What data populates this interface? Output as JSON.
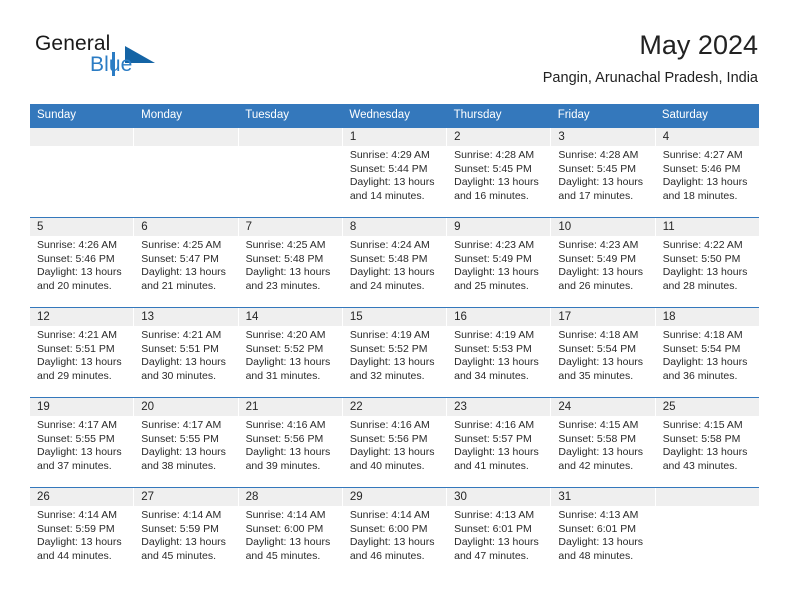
{
  "brand": {
    "name_part1": "General",
    "name_part2": "Blue"
  },
  "header": {
    "title": "May 2024",
    "location": "Pangin, Arunachal Pradesh, India"
  },
  "colors": {
    "header_blue": "#3478bc",
    "brand_blue": "#2b7cc4",
    "date_band_gray": "#efefef",
    "text": "#2a2a2a"
  },
  "weekdays": [
    "Sunday",
    "Monday",
    "Tuesday",
    "Wednesday",
    "Thursday",
    "Friday",
    "Saturday"
  ],
  "weeks": [
    [
      {
        "date": "",
        "sunrise": "",
        "sunset": "",
        "daylight": "",
        "empty": true
      },
      {
        "date": "",
        "sunrise": "",
        "sunset": "",
        "daylight": "",
        "empty": true
      },
      {
        "date": "",
        "sunrise": "",
        "sunset": "",
        "daylight": "",
        "empty": true
      },
      {
        "date": "1",
        "sunrise": "Sunrise: 4:29 AM",
        "sunset": "Sunset: 5:44 PM",
        "daylight": "Daylight: 13 hours and 14 minutes."
      },
      {
        "date": "2",
        "sunrise": "Sunrise: 4:28 AM",
        "sunset": "Sunset: 5:45 PM",
        "daylight": "Daylight: 13 hours and 16 minutes."
      },
      {
        "date": "3",
        "sunrise": "Sunrise: 4:28 AM",
        "sunset": "Sunset: 5:45 PM",
        "daylight": "Daylight: 13 hours and 17 minutes."
      },
      {
        "date": "4",
        "sunrise": "Sunrise: 4:27 AM",
        "sunset": "Sunset: 5:46 PM",
        "daylight": "Daylight: 13 hours and 18 minutes."
      }
    ],
    [
      {
        "date": "5",
        "sunrise": "Sunrise: 4:26 AM",
        "sunset": "Sunset: 5:46 PM",
        "daylight": "Daylight: 13 hours and 20 minutes."
      },
      {
        "date": "6",
        "sunrise": "Sunrise: 4:25 AM",
        "sunset": "Sunset: 5:47 PM",
        "daylight": "Daylight: 13 hours and 21 minutes."
      },
      {
        "date": "7",
        "sunrise": "Sunrise: 4:25 AM",
        "sunset": "Sunset: 5:48 PM",
        "daylight": "Daylight: 13 hours and 23 minutes."
      },
      {
        "date": "8",
        "sunrise": "Sunrise: 4:24 AM",
        "sunset": "Sunset: 5:48 PM",
        "daylight": "Daylight: 13 hours and 24 minutes."
      },
      {
        "date": "9",
        "sunrise": "Sunrise: 4:23 AM",
        "sunset": "Sunset: 5:49 PM",
        "daylight": "Daylight: 13 hours and 25 minutes."
      },
      {
        "date": "10",
        "sunrise": "Sunrise: 4:23 AM",
        "sunset": "Sunset: 5:49 PM",
        "daylight": "Daylight: 13 hours and 26 minutes."
      },
      {
        "date": "11",
        "sunrise": "Sunrise: 4:22 AM",
        "sunset": "Sunset: 5:50 PM",
        "daylight": "Daylight: 13 hours and 28 minutes."
      }
    ],
    [
      {
        "date": "12",
        "sunrise": "Sunrise: 4:21 AM",
        "sunset": "Sunset: 5:51 PM",
        "daylight": "Daylight: 13 hours and 29 minutes."
      },
      {
        "date": "13",
        "sunrise": "Sunrise: 4:21 AM",
        "sunset": "Sunset: 5:51 PM",
        "daylight": "Daylight: 13 hours and 30 minutes."
      },
      {
        "date": "14",
        "sunrise": "Sunrise: 4:20 AM",
        "sunset": "Sunset: 5:52 PM",
        "daylight": "Daylight: 13 hours and 31 minutes."
      },
      {
        "date": "15",
        "sunrise": "Sunrise: 4:19 AM",
        "sunset": "Sunset: 5:52 PM",
        "daylight": "Daylight: 13 hours and 32 minutes."
      },
      {
        "date": "16",
        "sunrise": "Sunrise: 4:19 AM",
        "sunset": "Sunset: 5:53 PM",
        "daylight": "Daylight: 13 hours and 34 minutes."
      },
      {
        "date": "17",
        "sunrise": "Sunrise: 4:18 AM",
        "sunset": "Sunset: 5:54 PM",
        "daylight": "Daylight: 13 hours and 35 minutes."
      },
      {
        "date": "18",
        "sunrise": "Sunrise: 4:18 AM",
        "sunset": "Sunset: 5:54 PM",
        "daylight": "Daylight: 13 hours and 36 minutes."
      }
    ],
    [
      {
        "date": "19",
        "sunrise": "Sunrise: 4:17 AM",
        "sunset": "Sunset: 5:55 PM",
        "daylight": "Daylight: 13 hours and 37 minutes."
      },
      {
        "date": "20",
        "sunrise": "Sunrise: 4:17 AM",
        "sunset": "Sunset: 5:55 PM",
        "daylight": "Daylight: 13 hours and 38 minutes."
      },
      {
        "date": "21",
        "sunrise": "Sunrise: 4:16 AM",
        "sunset": "Sunset: 5:56 PM",
        "daylight": "Daylight: 13 hours and 39 minutes."
      },
      {
        "date": "22",
        "sunrise": "Sunrise: 4:16 AM",
        "sunset": "Sunset: 5:56 PM",
        "daylight": "Daylight: 13 hours and 40 minutes."
      },
      {
        "date": "23",
        "sunrise": "Sunrise: 4:16 AM",
        "sunset": "Sunset: 5:57 PM",
        "daylight": "Daylight: 13 hours and 41 minutes."
      },
      {
        "date": "24",
        "sunrise": "Sunrise: 4:15 AM",
        "sunset": "Sunset: 5:58 PM",
        "daylight": "Daylight: 13 hours and 42 minutes."
      },
      {
        "date": "25",
        "sunrise": "Sunrise: 4:15 AM",
        "sunset": "Sunset: 5:58 PM",
        "daylight": "Daylight: 13 hours and 43 minutes."
      }
    ],
    [
      {
        "date": "26",
        "sunrise": "Sunrise: 4:14 AM",
        "sunset": "Sunset: 5:59 PM",
        "daylight": "Daylight: 13 hours and 44 minutes."
      },
      {
        "date": "27",
        "sunrise": "Sunrise: 4:14 AM",
        "sunset": "Sunset: 5:59 PM",
        "daylight": "Daylight: 13 hours and 45 minutes."
      },
      {
        "date": "28",
        "sunrise": "Sunrise: 4:14 AM",
        "sunset": "Sunset: 6:00 PM",
        "daylight": "Daylight: 13 hours and 45 minutes."
      },
      {
        "date": "29",
        "sunrise": "Sunrise: 4:14 AM",
        "sunset": "Sunset: 6:00 PM",
        "daylight": "Daylight: 13 hours and 46 minutes."
      },
      {
        "date": "30",
        "sunrise": "Sunrise: 4:13 AM",
        "sunset": "Sunset: 6:01 PM",
        "daylight": "Daylight: 13 hours and 47 minutes."
      },
      {
        "date": "31",
        "sunrise": "Sunrise: 4:13 AM",
        "sunset": "Sunset: 6:01 PM",
        "daylight": "Daylight: 13 hours and 48 minutes."
      },
      {
        "date": "",
        "sunrise": "",
        "sunset": "",
        "daylight": "",
        "empty": true
      }
    ]
  ]
}
